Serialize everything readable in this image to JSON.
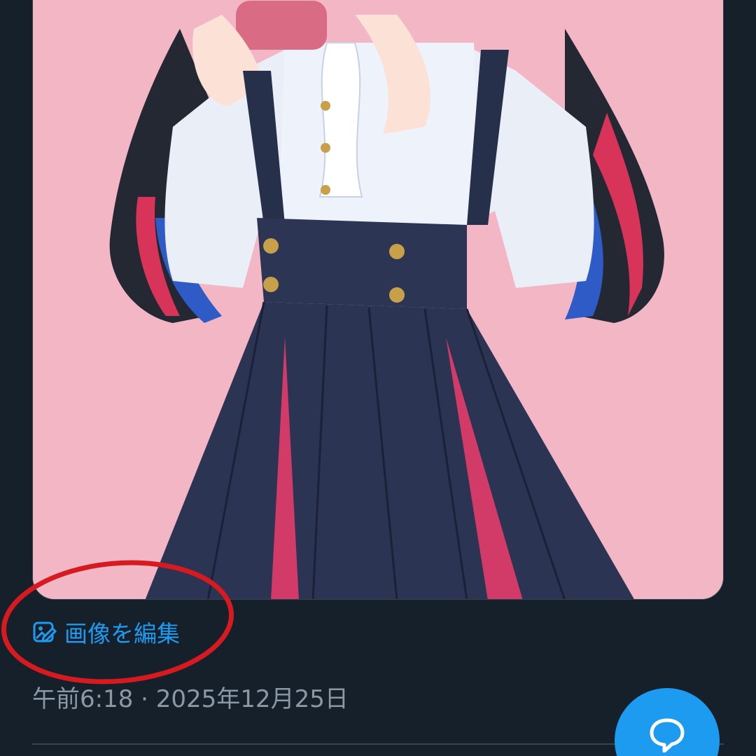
{
  "post": {
    "media": {
      "icon": "anime-girl-illustration"
    },
    "edit_image_label": "画像を編集",
    "edit_image_icon": "image-edit-icon",
    "timestamp": "午前6:18 · 2025年12月25日"
  },
  "annotation": {
    "shape": "ellipse",
    "color": "#d71920"
  },
  "fab": {
    "icon": "reply-bubble-icon"
  },
  "colors": {
    "background": "#15202b",
    "accent": "#1d9bf0",
    "secondary_text": "#8b98a5",
    "divider": "#38444d",
    "image_background": "#f3b6c5"
  }
}
